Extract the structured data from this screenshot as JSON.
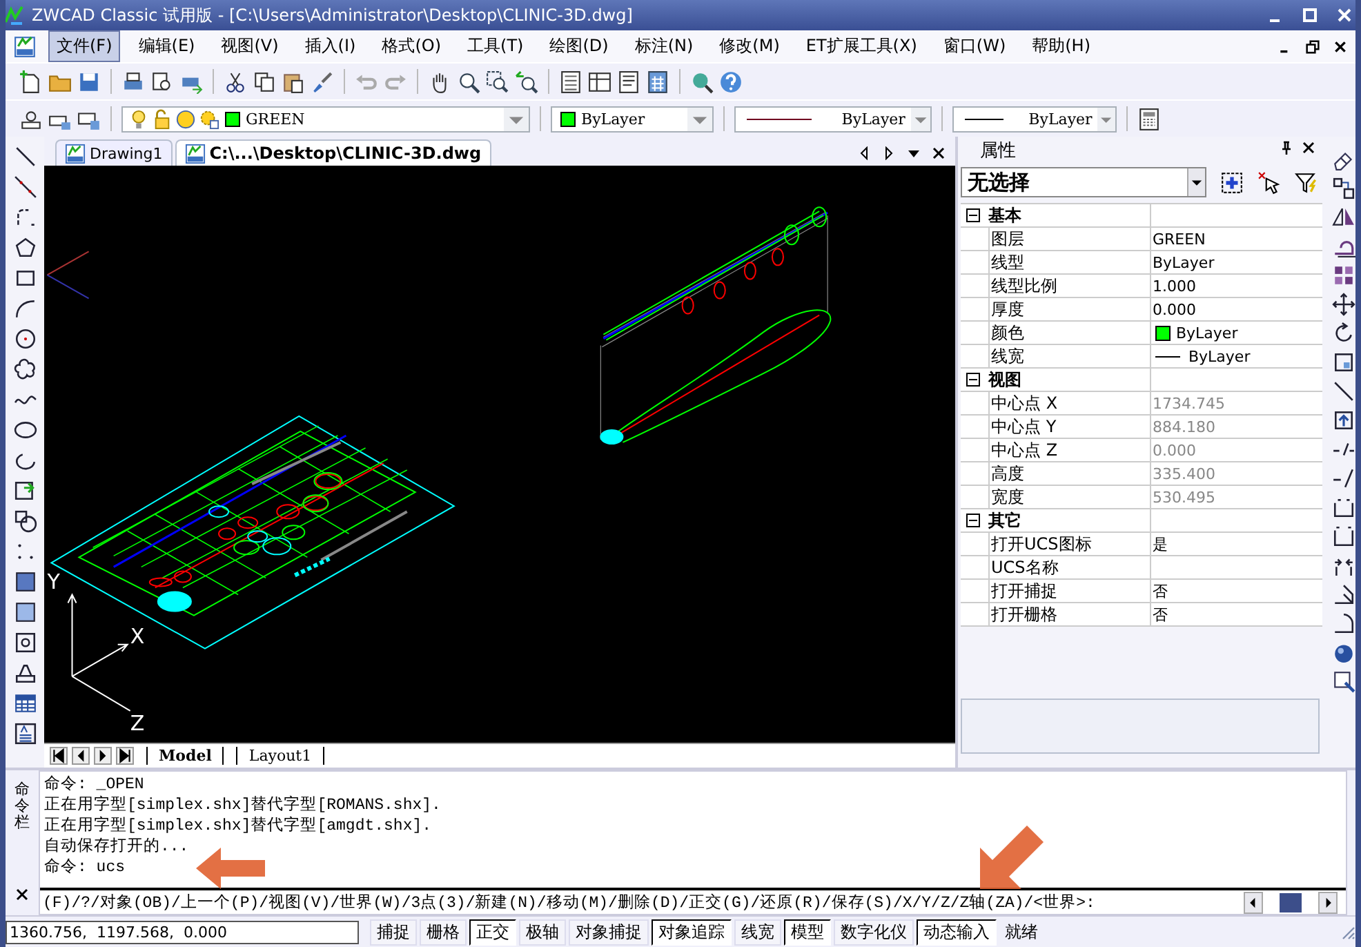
{
  "window": {
    "title": "ZWCAD Classic 试用版 - [C:\\Users\\Administrator\\Desktop\\CLINIC-3D.dwg]"
  },
  "menu": [
    {
      "label": "文件(F)",
      "selected": true
    },
    {
      "label": "编辑(E)",
      "selected": false
    },
    {
      "label": "视图(V)",
      "selected": false
    },
    {
      "label": "插入(I)",
      "selected": false
    },
    {
      "label": "格式(O)",
      "selected": false
    },
    {
      "label": "工具(T)",
      "selected": false
    },
    {
      "label": "绘图(D)",
      "selected": false
    },
    {
      "label": "标注(N)",
      "selected": false
    },
    {
      "label": "修改(M)",
      "selected": false
    },
    {
      "label": "ET扩展工具(X)",
      "selected": false
    },
    {
      "label": "窗口(W)",
      "selected": false
    },
    {
      "label": "帮助(H)",
      "selected": false
    }
  ],
  "layer_toolbar": {
    "layer": "GREEN",
    "color_setting": "ByLayer",
    "linetype": "ByLayer",
    "lineweight": "ByLayer"
  },
  "document_tabs": [
    {
      "label": "Drawing1",
      "selected": false
    },
    {
      "label": "C:\\...\\Desktop\\CLINIC-3D.dwg",
      "selected": true
    }
  ],
  "canvas": {
    "axis_labels": [
      "Y",
      "X",
      "Z"
    ]
  },
  "layout_tabs": [
    {
      "label": "Model",
      "selected": true
    },
    {
      "label": "Layout1",
      "selected": false
    }
  ],
  "properties": {
    "title": "属性",
    "selection": "无选择",
    "sections": [
      {
        "title": "基本",
        "expanded": true,
        "rows": [
          {
            "name": "图层",
            "value": "GREEN",
            "kind": "text",
            "readonly": false
          },
          {
            "name": "线型",
            "value": "ByLayer",
            "kind": "text",
            "readonly": false
          },
          {
            "name": "线型比例",
            "value": "1.000",
            "kind": "text",
            "readonly": false
          },
          {
            "name": "厚度",
            "value": "0.000",
            "kind": "text",
            "readonly": false
          },
          {
            "name": "颜色",
            "value": "ByLayer",
            "kind": "color",
            "readonly": false
          },
          {
            "name": "线宽",
            "value": "ByLayer",
            "kind": "lineweight",
            "readonly": false
          }
        ]
      },
      {
        "title": "视图",
        "expanded": true,
        "rows": [
          {
            "name": "中心点 X",
            "value": "1734.745",
            "kind": "text",
            "readonly": true
          },
          {
            "name": "中心点 Y",
            "value": "884.180",
            "kind": "text",
            "readonly": true
          },
          {
            "name": "中心点 Z",
            "value": "0.000",
            "kind": "text",
            "readonly": true
          },
          {
            "name": "高度",
            "value": "335.400",
            "kind": "text",
            "readonly": true
          },
          {
            "name": "宽度",
            "value": "530.495",
            "kind": "text",
            "readonly": true
          }
        ]
      },
      {
        "title": "其它",
        "expanded": true,
        "rows": [
          {
            "name": "打开UCS图标",
            "value": "是",
            "kind": "text",
            "readonly": false
          },
          {
            "name": "UCS名称",
            "value": "",
            "kind": "text",
            "readonly": false
          },
          {
            "name": "打开捕捉",
            "value": "否",
            "kind": "text",
            "readonly": false
          },
          {
            "name": "打开栅格",
            "value": "否",
            "kind": "text",
            "readonly": false
          }
        ]
      }
    ]
  },
  "command_line": {
    "label": "命令栏",
    "history": [
      "命令: _OPEN",
      "正在用字型[simplex.shx]替代字型[ROMANS.shx].",
      "正在用字型[simplex.shx]替代字型[amgdt.shx].",
      "自动保存打开的...",
      "命令: ucs"
    ],
    "prompt": "(F)/?/对象(OB)/上一个(P)/视图(V)/世界(W)/3点(3)/新建(N)/移动(M)/删除(D)/正交(G)/还原(R)/保存(S)/X/Y/Z/Z轴(ZA)/<世界>:"
  },
  "status_bar": {
    "coordinates": "1360.756,  1197.568,  0.000",
    "toggles": [
      {
        "label": "捕捉",
        "on": false
      },
      {
        "label": "栅格",
        "on": false
      },
      {
        "label": "正交",
        "on": true
      },
      {
        "label": "极轴",
        "on": false
      },
      {
        "label": "对象捕捉",
        "on": false
      },
      {
        "label": "对象追踪",
        "on": true
      },
      {
        "label": "线宽",
        "on": false
      },
      {
        "label": "模型",
        "on": true
      },
      {
        "label": "数字化仪",
        "on": false
      },
      {
        "label": "动态输入",
        "on": true
      }
    ],
    "status": "就绪"
  }
}
